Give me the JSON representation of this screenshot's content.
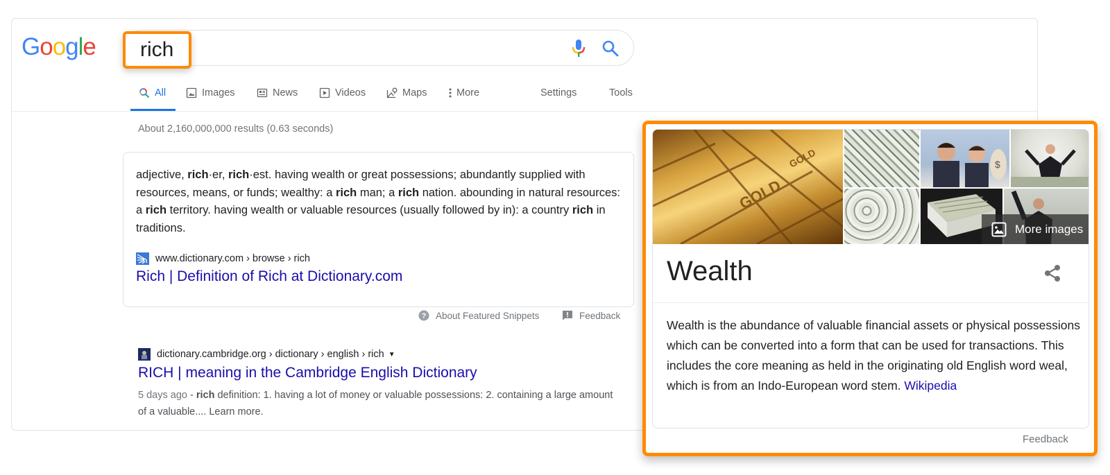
{
  "logo": {
    "text": "Google",
    "letters": [
      "G",
      "o",
      "o",
      "g",
      "l",
      "e"
    ],
    "colors": [
      "#4285f4",
      "#ea4335",
      "#fbbc05",
      "#4285f4",
      "#34a853",
      "#ea4335"
    ]
  },
  "search": {
    "query": "rich",
    "mic_icon": "microphone-icon",
    "search_icon": "search-icon"
  },
  "tabs": [
    {
      "label": "All",
      "icon": "search-icon",
      "active": true
    },
    {
      "label": "Images",
      "icon": "image-icon",
      "active": false
    },
    {
      "label": "News",
      "icon": "news-icon",
      "active": false
    },
    {
      "label": "Videos",
      "icon": "play-icon",
      "active": false
    },
    {
      "label": "Maps",
      "icon": "map-pin-icon",
      "active": false
    },
    {
      "label": "More",
      "icon": "more-vert-icon",
      "active": false
    }
  ],
  "tools": {
    "settings": "Settings",
    "tools": "Tools"
  },
  "result_stats": "About 2,160,000,000 results (0.63 seconds)",
  "featured_snippet": {
    "text_parts": [
      {
        "t": "adjective, ",
        "b": false
      },
      {
        "t": "rich",
        "b": true
      },
      {
        "t": "·er, ",
        "b": false
      },
      {
        "t": "rich",
        "b": true
      },
      {
        "t": "·est. having wealth or great possessions; abundantly supplied with resources, means, or funds; wealthy: a ",
        "b": false
      },
      {
        "t": "rich",
        "b": true
      },
      {
        "t": " man; a ",
        "b": false
      },
      {
        "t": "rich",
        "b": true
      },
      {
        "t": " nation. abounding in natural resources: a ",
        "b": false
      },
      {
        "t": "rich",
        "b": true
      },
      {
        "t": " territory. having wealth or valuable resources (usually followed by in): a country ",
        "b": false
      },
      {
        "t": "rich",
        "b": true
      },
      {
        "t": " in traditions.",
        "b": false
      }
    ],
    "cite": "www.dictionary.com › browse › rich",
    "title": "Rich | Definition of Rich at Dictionary.com",
    "about_label": "About Featured Snippets",
    "feedback_label": "Feedback"
  },
  "result2": {
    "cite": "dictionary.cambridge.org › dictionary › english › rich",
    "title": "RICH | meaning in the Cambridge English Dictionary",
    "date": "5 days ago",
    "desc_parts": [
      {
        "t": " - ",
        "b": false
      },
      {
        "t": "rich",
        "b": true
      },
      {
        "t": " definition: 1. having a lot of money or valuable possessions: 2. containing a large amount of a valuable.... Learn more.",
        "b": false
      }
    ]
  },
  "knowledge_panel": {
    "images": [
      "gold-bars",
      "dollar-bills",
      "kids-with-money",
      "man-in-money-rain",
      "rolled-dollars",
      "book-of-money",
      "man-throwing-money"
    ],
    "more_images_label": "More images",
    "title": "Wealth",
    "description": "Wealth is the abundance of valuable financial assets or physical possessions which can be converted into a form that can be used for transactions. This includes the core meaning as held in the originating old English word weal, which is from an Indo-European word stem. ",
    "source_link": "Wikipedia",
    "feedback_label": "Feedback"
  },
  "colors": {
    "highlight": "#ff8a00",
    "link": "#1a0dab",
    "active_tab": "#1a73e8"
  }
}
